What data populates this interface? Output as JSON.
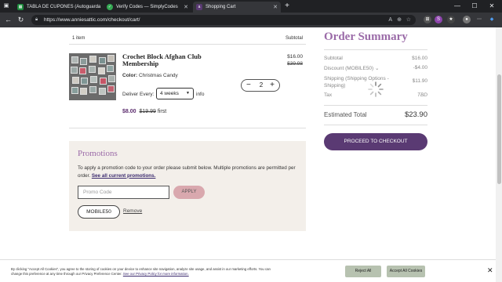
{
  "browser": {
    "tabs": [
      {
        "title": "TABLA DE CUPONES (Autoguarda"
      },
      {
        "title": "Verify Codes — SimplyCodes"
      },
      {
        "title": "Shopping Cart"
      }
    ],
    "url": "https://www.anniesattic.com/checkout/cart/"
  },
  "cart": {
    "item_count": "1 item",
    "subtotal_header": "Subtotal",
    "item": {
      "title": "Crochet Block Afghan Club Membership",
      "color_label": "Color:",
      "color_value": "Christmas Candy",
      "deliver_label": "Deliver Every:",
      "deliver_value": "4 weeks",
      "info_label": "info",
      "price_now": "$8.00",
      "price_was": "$19.99",
      "price_suffix": "first",
      "quantity": "2",
      "line_subtotal": "$16.00",
      "line_subtotal_was": "$39.98"
    }
  },
  "promotions": {
    "title": "Promotions",
    "text": "To apply a promotion code to your order please submit below. Multiple promotions are permitted per order.",
    "link": "See all current promotions.",
    "input_placeholder": "Promo Code",
    "apply_label": "APPLY",
    "applied_code": "MOBILE50",
    "remove_label": "Remove"
  },
  "order_summary": {
    "title": "Order Summary",
    "subtotal_label": "Subtotal",
    "subtotal_value": "$16.00",
    "discount_label": "Discount (MOBILE50)",
    "discount_value": "-$4.00",
    "shipping_label": "Shipping (Shipping Options - Shipping)",
    "shipping_value": "$11.90",
    "tax_label": "Tax",
    "tax_value": "TBD",
    "total_label": "Estimated Total",
    "total_value": "$23.90",
    "checkout_label": "PROCEED TO CHECKOUT"
  },
  "cookie": {
    "text": "By clicking \"Accept All Cookies\", you agree to the storing of cookies on your device to enhance site navigation, analyze site usage, and assist in our marketing efforts. You can change this preference at any time through our Privacy Preference Center.",
    "link": "See our Privacy Policy for more information.",
    "reject_label": "Reject All",
    "accept_label": "Accept All Cookies"
  },
  "colors": {
    "accent": "#9b6ba8",
    "checkout": "#5a3a73",
    "apply": "#d9a8ae",
    "cookie_btn": "#b7c2b0"
  }
}
